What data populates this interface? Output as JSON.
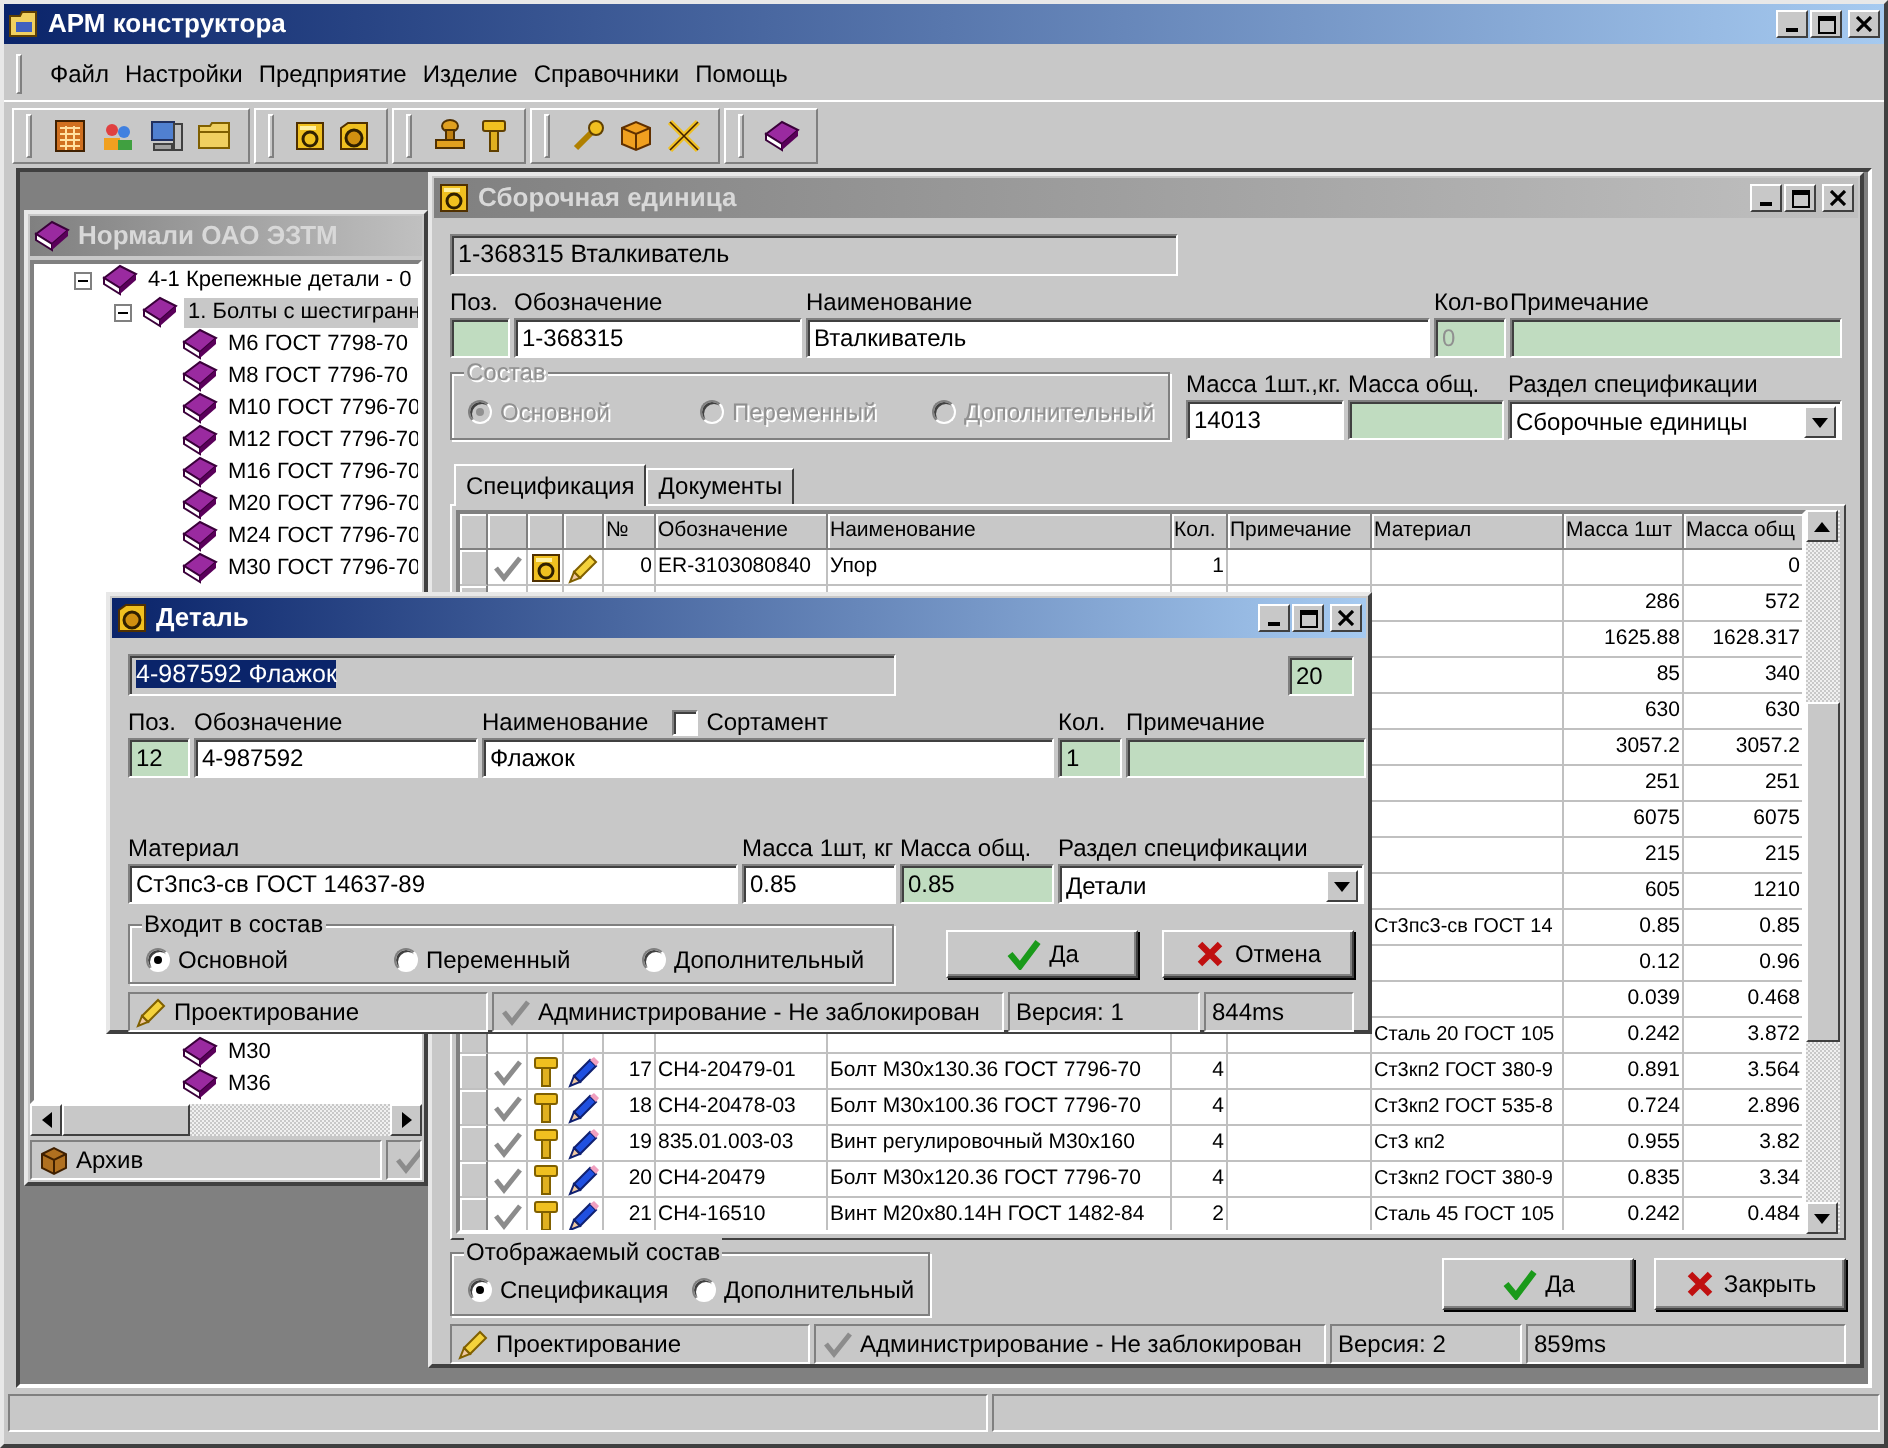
{
  "window": {
    "title": "АРМ конструктора"
  },
  "menu": [
    "Файл",
    "Настройки",
    "Предприятие",
    "Изделие",
    "Справочники",
    "Помощь"
  ],
  "tree_window": {
    "title": "Нормали ОАО ЭЗТМ",
    "status": "Архив",
    "tree": [
      {
        "label": "4-1 Крепежные детали - 0",
        "expanded": true,
        "selected": false,
        "children": [
          {
            "label": "1. Болты с шестигранн",
            "expanded": true,
            "selected": true,
            "children": [
              {
                "label": "М6 ГОСТ 7798-70",
                "selected": false
              },
              {
                "label": "М8 ГОСТ 7796-70",
                "selected": false
              },
              {
                "label": "М10 ГОСТ 7796-70",
                "selected": false
              },
              {
                "label": "М12 ГОСТ 7796-70",
                "selected": false
              },
              {
                "label": "М16 ГОСТ 7796-70",
                "selected": false
              },
              {
                "label": "М20 ГОСТ 7796-70",
                "selected": false
              },
              {
                "label": "М24 ГОСТ 7796-70",
                "selected": false
              },
              {
                "label": "М30 ГОСТ 7796-70",
                "selected": false
              },
              {
                "label": "М30",
                "selected": false
              },
              {
                "label": "М36",
                "selected": false
              }
            ]
          }
        ]
      }
    ]
  },
  "assembly_window": {
    "title": "Сборочная единица",
    "header": "1-368315 Вталкиватель",
    "fields": [
      {
        "label": "Поз.",
        "readonly": true
      },
      {
        "label": "Обозначение",
        "value": "1-368315",
        "readonly": false
      },
      {
        "label": "Наименование",
        "value": "Вталкиватель",
        "readonly": false
      },
      {
        "label": "Кол-во",
        "value": "0",
        "readonly": true
      },
      {
        "label": "Примечание",
        "readonly": true
      }
    ],
    "composition": {
      "label": "Состав",
      "disabled": true,
      "options": [
        {
          "label": "Основной",
          "selected": true
        },
        {
          "label": "Переменный",
          "selected": false
        },
        {
          "label": "Дополнительный",
          "selected": false
        }
      ]
    },
    "mass_fields": [
      {
        "label": "Масса 1шт.,кг.",
        "value": "14013",
        "readonly": false
      },
      {
        "label": "Масса общ.",
        "readonly": true
      }
    ],
    "section": {
      "label": "Раздел спецификации",
      "value": "Сборочные единицы"
    },
    "tabs": [
      {
        "label": "Спецификация",
        "selected": true
      },
      {
        "label": "Документы",
        "selected": false
      }
    ],
    "table": {
      "columns": [
        "№",
        "Обозначение",
        "Наименование",
        "Кол.",
        "Примечание",
        "Материал",
        "Масса 1шт",
        "Масса общ"
      ],
      "rows": [
        {
          "kind": "assembly",
          "num": "0",
          "designation": "ER-3103080840",
          "name": "Упор",
          "qty": "1",
          "mass_total": "0"
        },
        {
          "mass_one": "286",
          "mass_total": "572"
        },
        {
          "mass_one": "1625.88",
          "mass_total": "1628.317"
        },
        {
          "mass_one": "85",
          "mass_total": "340"
        },
        {
          "mass_one": "630",
          "mass_total": "630"
        },
        {
          "mass_one": "3057.2",
          "mass_total": "3057.2"
        },
        {
          "mass_one": "251",
          "mass_total": "251"
        },
        {
          "mass_one": "6075",
          "mass_total": "6075"
        },
        {
          "mass_one": "215",
          "mass_total": "215"
        },
        {
          "mass_one": "605",
          "mass_total": "1210"
        },
        {
          "material": "Ст3пс3-св ГОСТ 14",
          "mass_one": "0.85",
          "mass_total": "0.85"
        },
        {
          "mass_one": "0.12",
          "mass_total": "0.96"
        },
        {
          "mass_one": "0.039",
          "mass_total": "0.468"
        },
        {
          "material": "Сталь 20 ГОСТ 105",
          "mass_one": "0.242",
          "mass_total": "3.872"
        },
        {
          "kind": "standard",
          "num": "17",
          "designation": "СН4-20479-01",
          "name": "Болт М30х130.36 ГОСТ 7796-70",
          "qty": "4",
          "material": "Ст3кп2 ГОСТ 380-9",
          "mass_one": "0.891",
          "mass_total": "3.564"
        },
        {
          "kind": "standard",
          "num": "18",
          "designation": "СН4-20478-03",
          "name": "Болт М30х100.36 ГОСТ 7796-70",
          "qty": "4",
          "material": "Ст3кп2 ГОСТ 535-8",
          "mass_one": "0.724",
          "mass_total": "2.896"
        },
        {
          "kind": "standard",
          "num": "19",
          "designation": "835.01.003-03",
          "name": "Винт регулировочный М30х160",
          "qty": "4",
          "material": "Ст3 кп2",
          "mass_one": "0.955",
          "mass_total": "3.82"
        },
        {
          "kind": "standard",
          "num": "20",
          "designation": "СН4-20479",
          "name": "Болт М30х120.36 ГОСТ 7796-70",
          "qty": "4",
          "material": "Ст3кп2 ГОСТ 380-9",
          "mass_one": "0.835",
          "mass_total": "3.34"
        },
        {
          "kind": "standard",
          "num": "21",
          "designation": "СН4-16510",
          "name": "Винт М20х80.14Н ГОСТ 1482-84",
          "qty": "2",
          "material": "Сталь 45 ГОСТ 105",
          "mass_one": "0.242",
          "mass_total": "0.484"
        }
      ]
    },
    "display": {
      "label": "Отображаемый состав",
      "disabled": false,
      "options": [
        {
          "label": "Спецификация",
          "selected": true
        },
        {
          "label": "Дополнительный",
          "selected": false
        }
      ]
    },
    "buttons": [
      {
        "label": "Да",
        "kind": "ok"
      },
      {
        "label": "Закрыть",
        "kind": "cancel"
      }
    ],
    "status_bar": [
      {
        "text": "Проектирование",
        "kind": "mode"
      },
      {
        "text": "Администрирование - Не заблокирован",
        "kind": "lock"
      },
      {
        "text": "Версия: 2",
        "kind": "plain"
      },
      {
        "text": "859ms",
        "kind": "plain"
      }
    ]
  },
  "detail_dialog": {
    "title": "Деталь",
    "header": "4-987592 Флажок",
    "header_selected": true,
    "count": "20",
    "fields": [
      {
        "label": "Поз.",
        "value": "12",
        "readonly": true
      },
      {
        "label": "Обозначение",
        "value": "4-987592",
        "readonly": false
      },
      {
        "label": "Наименование",
        "value": "Флажок",
        "readonly": false
      },
      {
        "label": "Кол.",
        "value": "1",
        "readonly": true
      },
      {
        "label": "Примечание",
        "readonly": true
      }
    ],
    "assortment": {
      "label": "Сортамент",
      "checked": false
    },
    "fields_2": [
      {
        "label": "Материал",
        "value": "Ст3пс3-св ГОСТ 14637-89",
        "readonly": false
      },
      {
        "label": "Масса 1шт, кг",
        "value": "0.85",
        "readonly": false
      },
      {
        "label": "Масса общ.",
        "value": "0.85",
        "readonly": true
      }
    ],
    "section": {
      "label": "Раздел спецификации",
      "value": "Детали"
    },
    "composition": {
      "label": "Входит в состав",
      "disabled": false,
      "options": [
        {
          "label": "Основной",
          "selected": true
        },
        {
          "label": "Переменный",
          "selected": false
        },
        {
          "label": "Дополнительный",
          "selected": false
        }
      ]
    },
    "buttons": [
      {
        "label": "Да",
        "kind": "ok"
      },
      {
        "label": "Отмена",
        "kind": "cancel"
      }
    ],
    "status_bar": [
      {
        "text": "Проектирование",
        "kind": "mode"
      },
      {
        "text": "Администрирование - Не заблокирован",
        "kind": "lock"
      },
      {
        "text": "Версия: 1",
        "kind": "plain"
      },
      {
        "text": "844ms",
        "kind": "plain"
      }
    ]
  }
}
